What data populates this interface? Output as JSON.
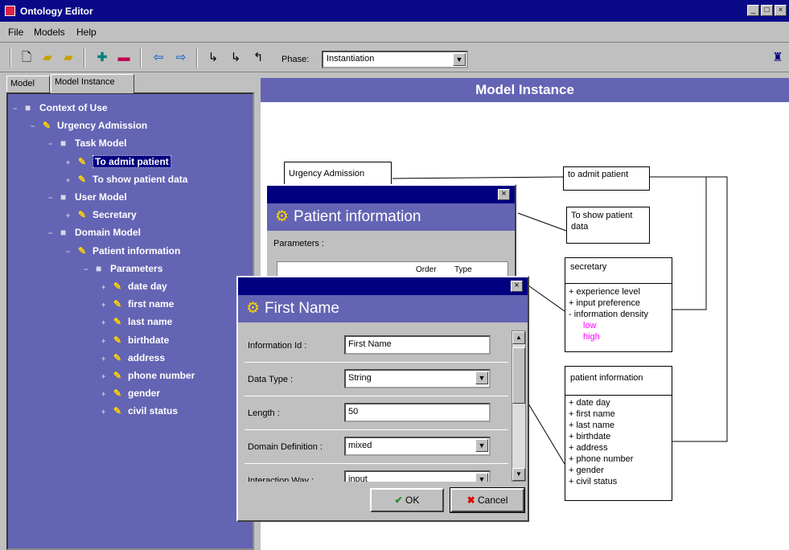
{
  "window": {
    "title": "Ontology Editor"
  },
  "menu": [
    "File",
    "Models",
    "Help"
  ],
  "toolbar": {
    "phase_label": "Phase:",
    "phase_value": "Instantiation"
  },
  "tabs": [
    "Model",
    "Model Instance"
  ],
  "tree": [
    {
      "label": "Context of Use",
      "exp": "−",
      "icon": "box"
    },
    {
      "label": "Urgency Admission",
      "exp": "−",
      "icon": "pencil"
    },
    {
      "label": "Task Model",
      "exp": "−",
      "icon": "box"
    },
    {
      "label": "To admit patient",
      "exp": "+",
      "icon": "pencil"
    },
    {
      "label": "To show patient data",
      "exp": "+",
      "icon": "pencil"
    },
    {
      "label": "User Model",
      "exp": "−",
      "icon": "box"
    },
    {
      "label": "Secretary",
      "exp": "+",
      "icon": "pencil"
    },
    {
      "label": "Domain Model",
      "exp": "−",
      "icon": "box"
    },
    {
      "label": "Patient information",
      "exp": "−",
      "icon": "pencil"
    },
    {
      "label": "Parameters",
      "exp": "−",
      "icon": "box"
    },
    {
      "label": "date day",
      "exp": "+",
      "icon": "pencil"
    },
    {
      "label": "first name",
      "exp": "+",
      "icon": "pencil"
    },
    {
      "label": "last name",
      "exp": "+",
      "icon": "pencil"
    },
    {
      "label": "birthdate",
      "exp": "+",
      "icon": "pencil"
    },
    {
      "label": "address",
      "exp": "+",
      "icon": "pencil"
    },
    {
      "label": "phone number",
      "exp": "+",
      "icon": "pencil"
    },
    {
      "label": "gender",
      "exp": "+",
      "icon": "pencil"
    },
    {
      "label": "civil status",
      "exp": "+",
      "icon": "pencil"
    }
  ],
  "panel_title": "Model Instance",
  "diagram": {
    "urgency": "Urgency Admission",
    "admit": "to admit patient",
    "show": "To show patient data",
    "secretary": {
      "title": "secretary",
      "items": [
        "+ experience level",
        "+ input preference",
        "- information density"
      ],
      "sub": [
        "low",
        "high"
      ]
    },
    "patient": {
      "title": "patient information",
      "items": [
        "+ date day",
        "+ first name",
        "+ last name",
        "+ birthdate",
        "+ address",
        "+ phone number",
        "+ gender",
        "+ civil status"
      ]
    }
  },
  "dialog_patient": {
    "title": "Patient information",
    "params_label": "Parameters :",
    "col_a": "Order",
    "col_b": "Type"
  },
  "dialog_first": {
    "title": "First Name",
    "fields": [
      {
        "label": "Information Id :",
        "value": "First Name",
        "combo": false
      },
      {
        "label": "Data Type :",
        "value": "String",
        "combo": true
      },
      {
        "label": "Length :",
        "value": "50",
        "combo": false
      },
      {
        "label": "Domain Definition :",
        "value": "mixed",
        "combo": true
      },
      {
        "label": "Interaction Way :",
        "value": "input",
        "combo": true
      }
    ],
    "ok": "OK",
    "cancel": "Cancel"
  },
  "colors": {
    "accent": "#6464b4",
    "titlebar": "#0a0a88",
    "pink": "#ff00ff"
  }
}
